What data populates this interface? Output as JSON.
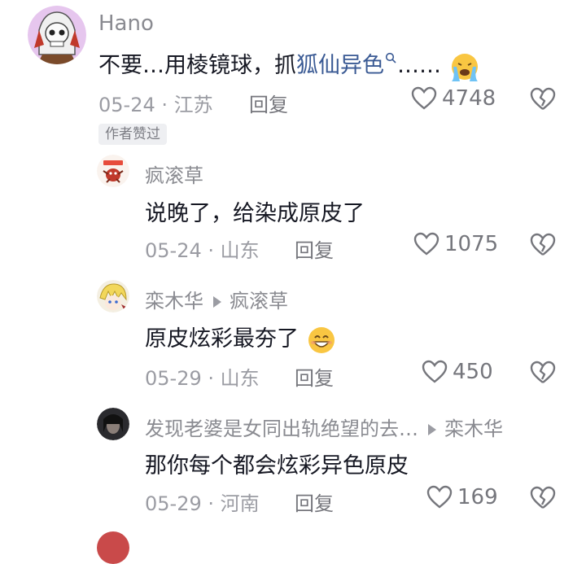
{
  "comments": [
    {
      "user": "Hano",
      "text_pre": "不要…用棱镜球，抓",
      "link": "狐仙异色",
      "text_post": "……",
      "date": "05-24",
      "location": "江苏",
      "reply_label": "回复",
      "likes": "4748",
      "tag": "作者赞过"
    }
  ],
  "replies": [
    {
      "user": "疯滚草",
      "text": "说晚了，给染成原皮了",
      "date": "05-24",
      "location": "山东",
      "reply_label": "回复",
      "likes": "1075"
    },
    {
      "user": "栾木华",
      "reply_to": "疯滚草",
      "text": "原皮炫彩最夯了",
      "date": "05-29",
      "location": "山东",
      "reply_label": "回复",
      "likes": "450"
    },
    {
      "user": "发现老婆是女同出轨绝望的去…",
      "reply_to": "栾木华",
      "text": "那你每个都会炫彩异色原皮",
      "date": "05-29",
      "location": "河南",
      "reply_label": "回复",
      "likes": "169"
    }
  ],
  "icons": {
    "heart": "heart-outline-icon",
    "dislike": "broken-heart-icon",
    "search": "search-icon",
    "arrow": "reply-arrow-icon"
  },
  "colors": {
    "text": "#161823",
    "secondary": "#9b9ca3",
    "link": "#3a5a94"
  }
}
